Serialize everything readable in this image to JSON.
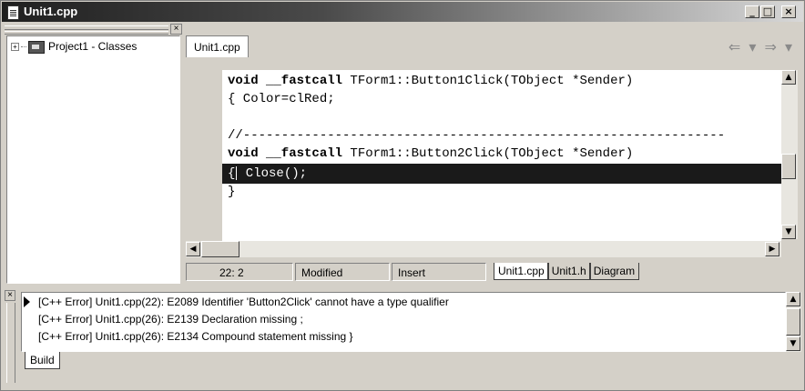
{
  "window": {
    "title": "Unit1.cpp",
    "buttons": {
      "minimize": "_",
      "maximize": "□",
      "close": "×"
    }
  },
  "left_panel": {
    "close_label": "×",
    "tree": {
      "expander": "+",
      "label": "Project1 - Classes"
    }
  },
  "editor": {
    "tab_label": "Unit1.cpp",
    "nav": {
      "back": "⇐ ▾",
      "forward": "⇒ ▾"
    },
    "lines": [
      {
        "kw": "void __fastcall",
        "rest": " TForm1::Button1Click(TObject *Sender)"
      },
      {
        "text": "{ Color=clRed;"
      },
      {
        "text": ""
      },
      {
        "text": "//---------------------------------------------------------------"
      },
      {
        "kw": "void __fastcall",
        "rest": " TForm1::Button2Click(TObject *Sender)"
      },
      {
        "pre": "{",
        "text": " Close();",
        "highlight": true
      },
      {
        "text": "}"
      }
    ],
    "scroll": {
      "up": "▲",
      "down": "▼",
      "left": "◀",
      "right": "▶"
    }
  },
  "status": {
    "position": "22: 2",
    "modified": "Modified",
    "mode": "Insert",
    "tabs": [
      "Unit1.cpp",
      "Unit1.h",
      "Diagram"
    ]
  },
  "messages": {
    "close_label": "×",
    "rows": [
      "[C++ Error] Unit1.cpp(22): E2089 Identifier 'Button2Click' cannot have a type qualifier",
      "[C++ Error] Unit1.cpp(26): E2139 Declaration missing ;",
      "[C++ Error] Unit1.cpp(26): E2134 Compound statement missing }"
    ],
    "tab_label": "Build",
    "scroll": {
      "up": "▲",
      "down": "▼"
    }
  }
}
